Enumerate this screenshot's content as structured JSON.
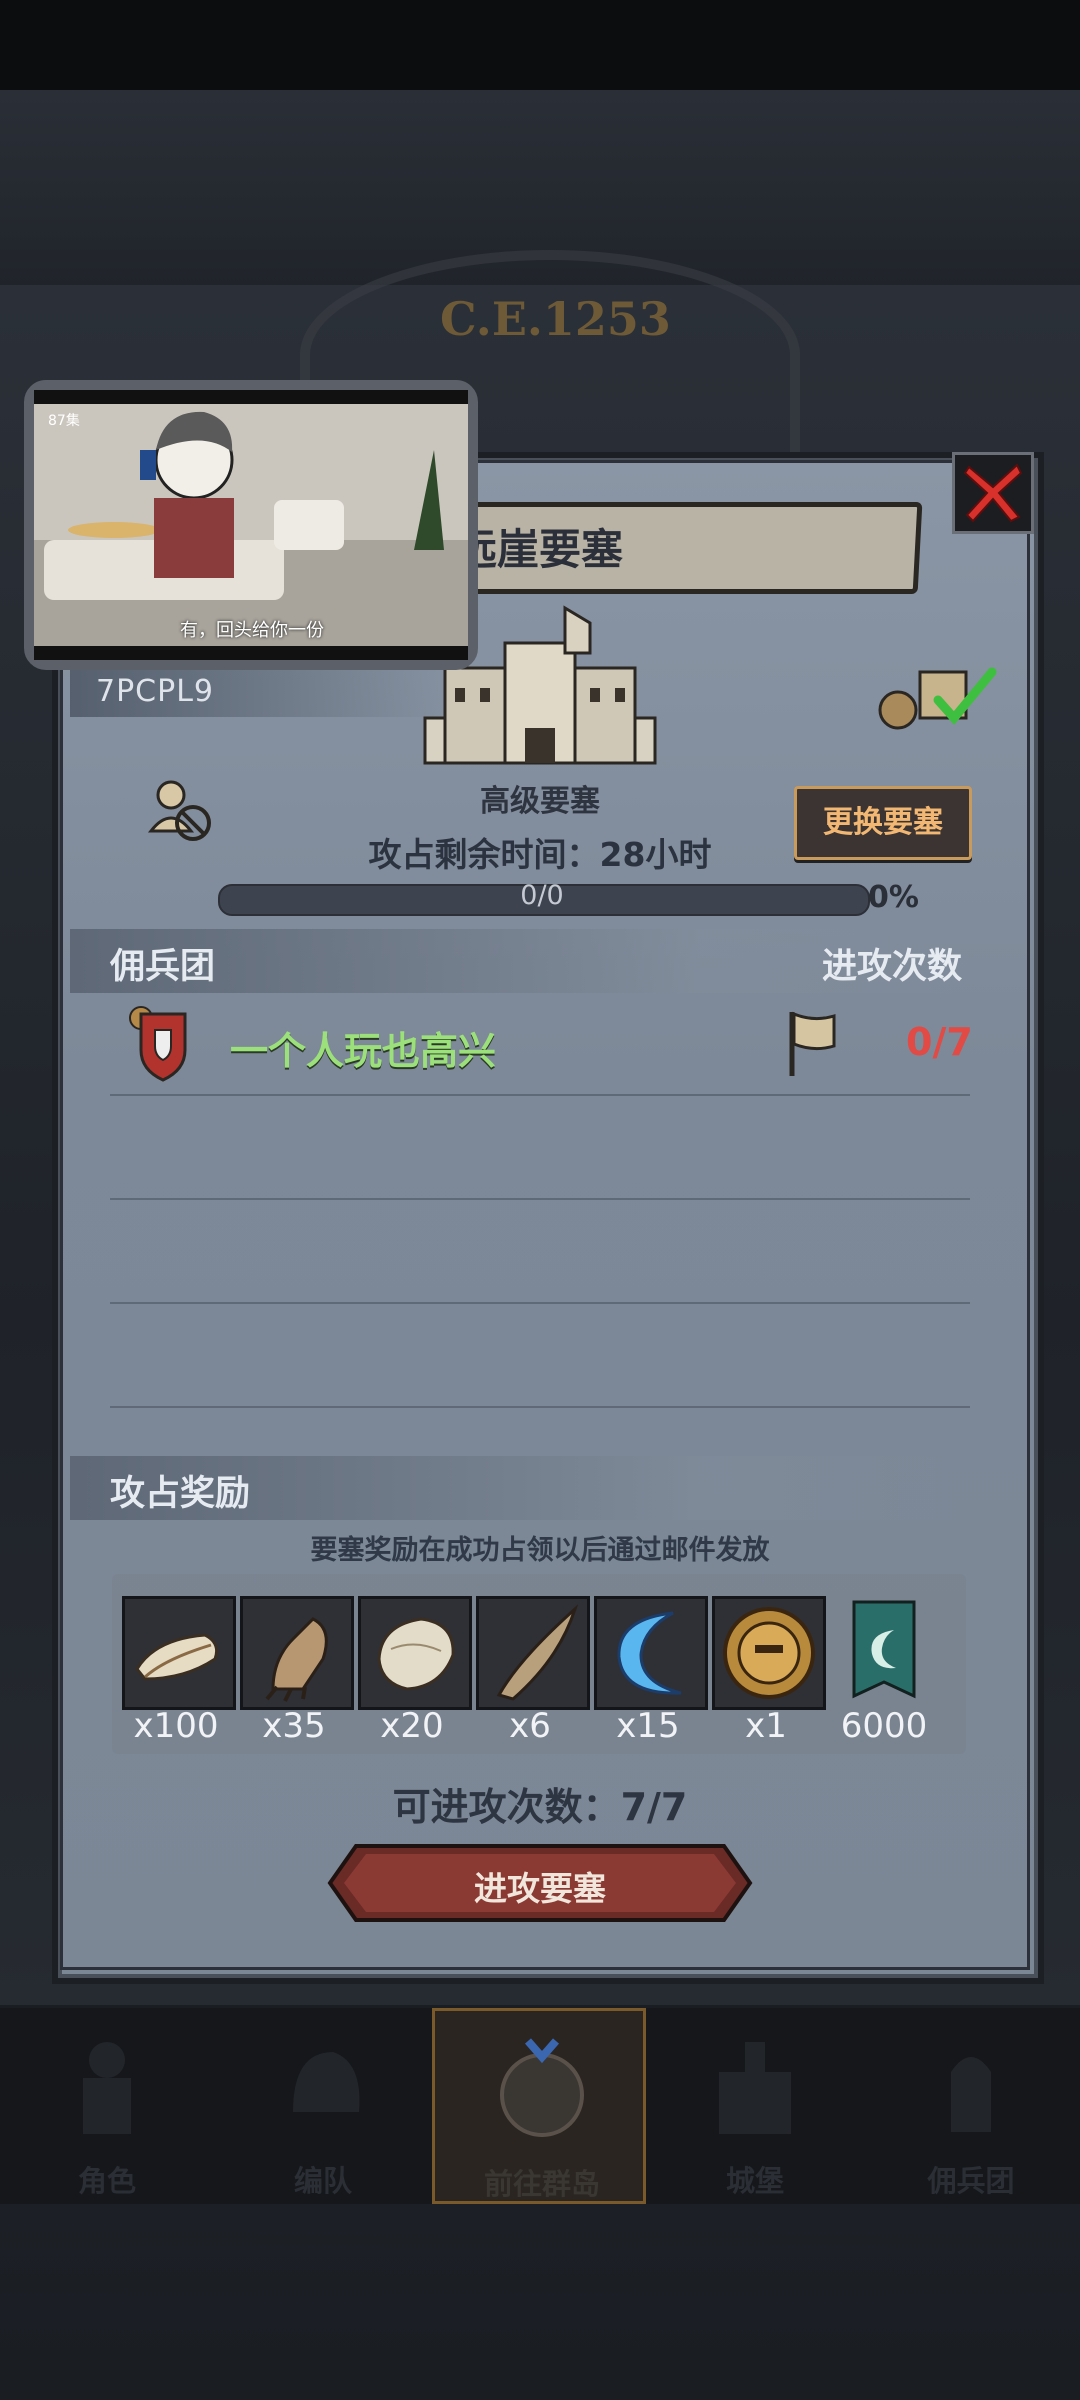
{
  "header": {
    "era": "C.E.1253"
  },
  "video_overlay": {
    "episode": "87集",
    "caption": "有，回头给你一份"
  },
  "fortress": {
    "title": "远崖要塞",
    "code": "7PCPL9",
    "type_label": "高级要塞",
    "change_button": "更换要塞",
    "timer_text": "攻占剩余时间：28小时",
    "progress": {
      "text": "0/0",
      "percent_text": "0%",
      "value": 0
    }
  },
  "mercenary_section": {
    "label": "佣兵团",
    "attack_count_label": "进攻次数",
    "rows": [
      {
        "name": "一个人玩也高兴",
        "count": "0/7"
      }
    ]
  },
  "rewards": {
    "label": "攻占奖励",
    "note": "要塞奖励在成功占领以后通过邮件发放",
    "items": [
      {
        "icon": "feather-icon",
        "qty": "x100"
      },
      {
        "icon": "claw-icon",
        "qty": "x35"
      },
      {
        "icon": "fur-pelt-icon",
        "qty": "x20"
      },
      {
        "icon": "horn-icon",
        "qty": "x6"
      },
      {
        "icon": "crescent-blade-icon",
        "qty": "x15"
      },
      {
        "icon": "helmet-medal-icon",
        "qty": "x1"
      },
      {
        "icon": "guild-banner-icon",
        "qty": "6000"
      }
    ]
  },
  "attempts_text": "可进攻次数：7/7",
  "attack_button": "进攻要塞",
  "nav": [
    {
      "label": "角色",
      "icon": "knight-icon"
    },
    {
      "label": "编队",
      "icon": "team-helmet-icon"
    },
    {
      "label": "前往群岛",
      "icon": "globe-compass-icon"
    },
    {
      "label": "城堡",
      "icon": "castle-icon"
    },
    {
      "label": "佣兵团",
      "icon": "mercenary-icon"
    }
  ],
  "colors": {
    "accent_gold": "#c89a5c",
    "merc_name_green": "#9be07a",
    "count_red": "#e14a45"
  }
}
